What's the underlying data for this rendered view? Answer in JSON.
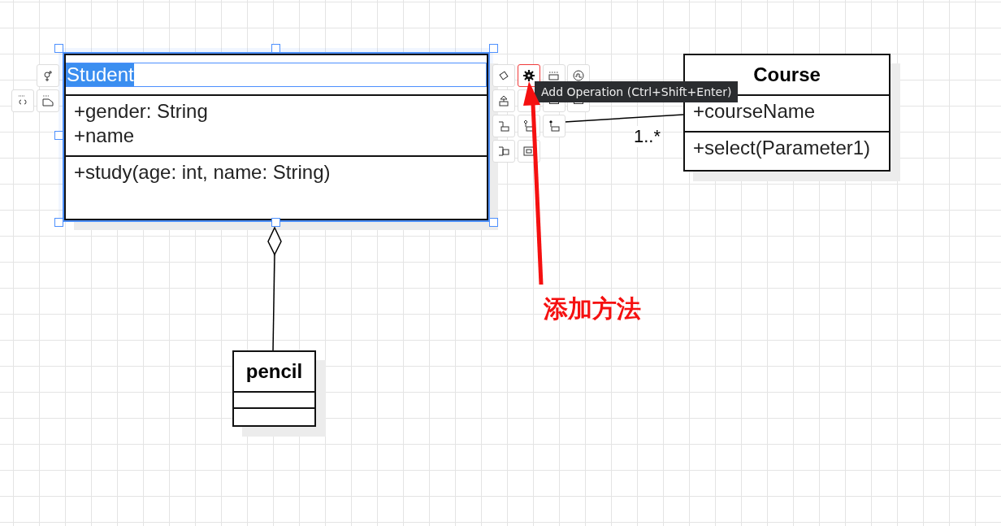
{
  "classes": [
    {
      "name": "Student",
      "attributes": [
        "+gender: String",
        "+name"
      ],
      "operations": [
        "+study(age: int, name: String)"
      ],
      "selected": true
    },
    {
      "name": "Course",
      "attributes": [
        "+courseName"
      ],
      "operations": [
        "+select(Parameter1)"
      ],
      "selected": false
    },
    {
      "name": "pencil",
      "selected": false
    }
  ],
  "side_tools": [
    {
      "kind": "person-plus"
    },
    {
      "kind": "braces"
    },
    {
      "kind": "note"
    }
  ],
  "toolbar": [
    {
      "kind": "diamond",
      "highlighted": false
    },
    {
      "kind": "gear",
      "highlighted": true
    },
    {
      "kind": "dashed-box",
      "highlighted": false
    },
    {
      "kind": "circle-wave",
      "highlighted": false
    },
    {
      "kind": "up-box",
      "highlighted": false
    },
    {
      "kind": "plain",
      "highlighted": false
    },
    {
      "kind": "box",
      "highlighted": false
    },
    {
      "kind": "box",
      "highlighted": false
    },
    {
      "kind": "step-box",
      "highlighted": false
    },
    {
      "kind": "hollow-diamond-box",
      "highlighted": false
    },
    {
      "kind": "filled-diamond-box",
      "highlighted": false
    },
    {
      "kind": "side-box",
      "highlighted": false
    },
    {
      "kind": "framed-box",
      "highlighted": false
    }
  ],
  "tooltip": "Add Operation (Ctrl+Shift+Enter)",
  "association": {
    "multiplicity": "1..*"
  },
  "annotation": "添加方法"
}
